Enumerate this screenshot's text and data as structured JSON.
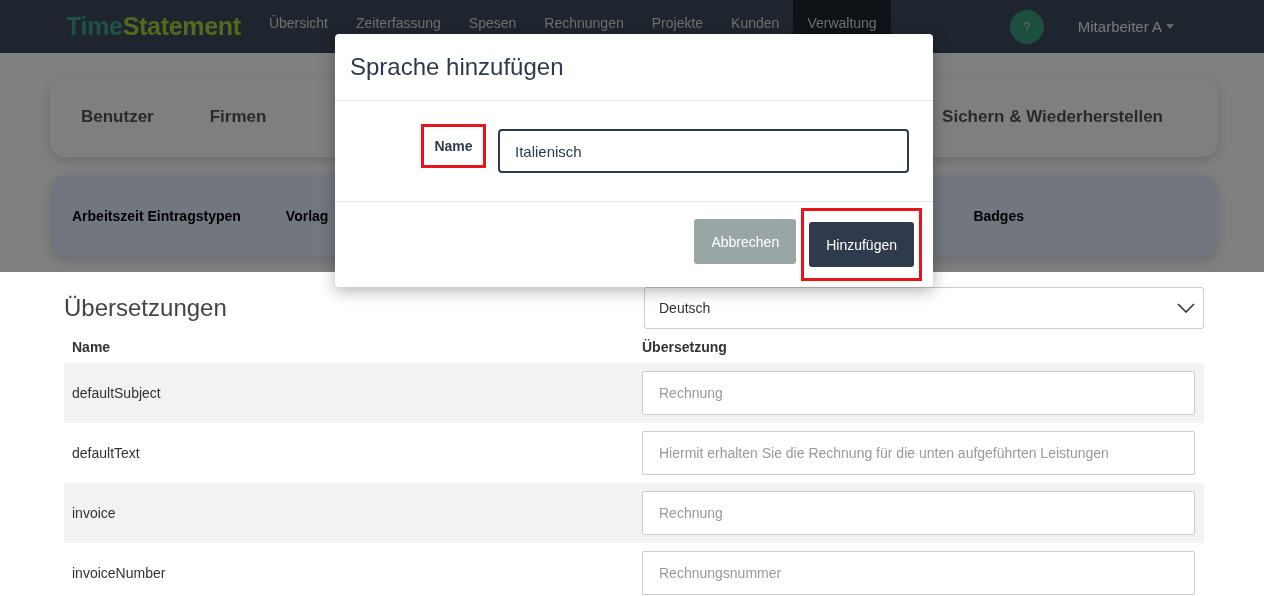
{
  "navbar": {
    "logo": {
      "first": "Time",
      "second": "Statement"
    },
    "links": [
      {
        "label": "Übersicht",
        "selected": false
      },
      {
        "label": "Zeiterfassung",
        "selected": false
      },
      {
        "label": "Spesen",
        "selected": false
      },
      {
        "label": "Rechnungen",
        "selected": false
      },
      {
        "label": "Projekte",
        "selected": false
      },
      {
        "label": "Kunden",
        "selected": false
      },
      {
        "label": "Verwaltung",
        "selected": true
      }
    ],
    "help": "?",
    "user": "Mitarbeiter A"
  },
  "admin_tabs": [
    {
      "label": "Benutzer"
    },
    {
      "label": "Firmen"
    },
    {
      "label": "Sichern & Wiederherstellen"
    }
  ],
  "settings_tabs": [
    {
      "label": "Arbeitszeit Eintragstypen"
    },
    {
      "label": "Vorlag"
    },
    {
      "label": "Badges"
    }
  ],
  "translations": {
    "title": "Übersetzungen",
    "language": "Deutsch",
    "columns": [
      "Name",
      "Übersetzung"
    ],
    "rows": [
      {
        "name": "defaultSubject",
        "placeholder": "Rechnung"
      },
      {
        "name": "defaultText",
        "placeholder": "Hiermit erhalten Sie die Rechnung für die unten aufgeführten Leistungen"
      },
      {
        "name": "invoice",
        "placeholder": "Rechnung"
      },
      {
        "name": "invoiceNumber",
        "placeholder": "Rechnungsnummer"
      }
    ]
  },
  "modal": {
    "title": "Sprache hinzufügen",
    "field": {
      "label": "Name",
      "value": "Italienisch",
      "highlighted": true
    },
    "buttons": [
      {
        "label": "Abbrechen",
        "kind": "secondary"
      },
      {
        "label": "Hinzufügen",
        "kind": "primary",
        "highlighted": true
      }
    ]
  }
}
